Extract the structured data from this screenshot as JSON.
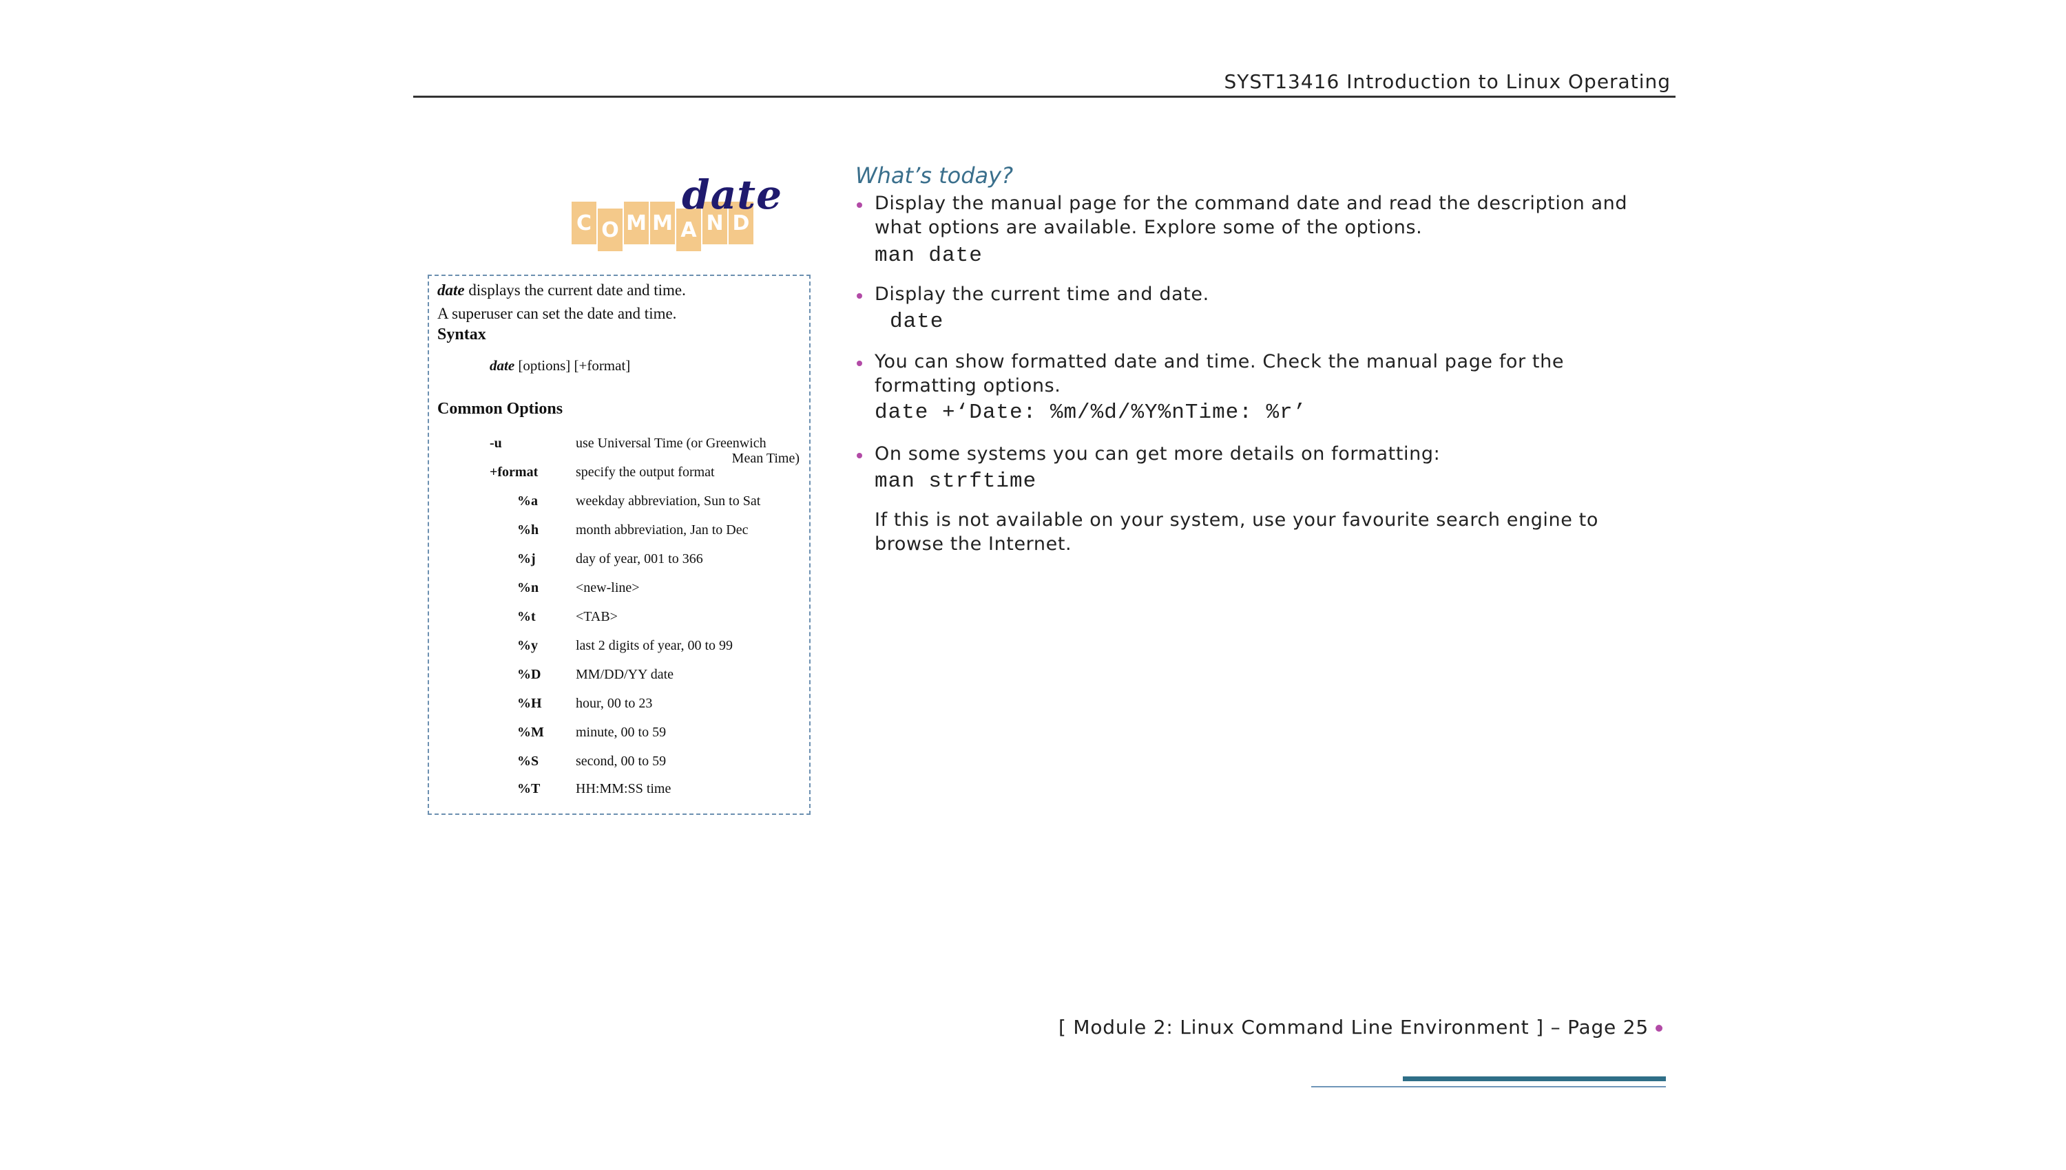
{
  "header": {
    "title": "SYST13416 Introduction to Linux Operating"
  },
  "logo": {
    "word": "date",
    "tiles": [
      "C",
      "O",
      "M",
      "M",
      "A",
      "N",
      "D"
    ]
  },
  "reference": {
    "intro_cmd": "date",
    "intro_rest": " displays the current date and time.",
    "intro_line2": "A superuser can set the date and time.",
    "syntax_heading": "Syntax",
    "syntax_cmd": "date",
    "syntax_args": " [options]  [+format]",
    "options_heading": "Common Options",
    "options": [
      {
        "flag": "-u",
        "desc": "use Universal Time (or Greenwich",
        "desc2": "Mean Time)"
      },
      {
        "flag": "+format",
        "desc": "specify the output format"
      },
      {
        "flag": "%a",
        "desc": "weekday abbreviation, Sun to Sat"
      },
      {
        "flag": "%h",
        "desc": "month abbreviation, Jan to Dec"
      },
      {
        "flag": "%j",
        "desc": "day of year, 001 to 366"
      },
      {
        "flag": "%n",
        "desc": "<new-line>"
      },
      {
        "flag": "%t",
        "desc": "<TAB>"
      },
      {
        "flag": "%y",
        "desc": "last 2 digits of year, 00 to 99"
      },
      {
        "flag": "%D",
        "desc": "MM/DD/YY date"
      },
      {
        "flag": "%H",
        "desc": "hour, 00 to 23"
      },
      {
        "flag": "%M",
        "desc": "minute, 00 to 59"
      },
      {
        "flag": "%S",
        "desc": "second, 00 to 59"
      },
      {
        "flag": "%T",
        "desc": "HH:MM:SS time"
      }
    ]
  },
  "content": {
    "title": "What’s today?",
    "bullets": [
      {
        "text_lines": [
          "Display the manual page for the command date and read the description and",
          "what options are available. Explore some of the options."
        ],
        "code": "man date"
      },
      {
        "text_lines": [
          "Display the current time and date."
        ],
        "code": "date"
      },
      {
        "text_lines": [
          "You can show formatted date and time. Check the manual page for the",
          "formatting options."
        ],
        "code": "date +‘Date: %m/%d/%Y%nTime: %r’"
      },
      {
        "text_lines": [
          "On some systems you can get more details on formatting:"
        ],
        "code": "man strftime",
        "after_lines": [
          "If this is not available on your system, use your favourite search engine to",
          "browse the Internet."
        ]
      }
    ]
  },
  "footer": {
    "text": "[ Module 2:  Linux Command Line Environment  ] – Page 25"
  },
  "colors": {
    "accent_title": "#3a6f8c",
    "bullet": "#b24aa6",
    "box_border": "#6b8fb0",
    "logo_tile": "#f4c98a",
    "logo_word": "#1f1a6e"
  }
}
